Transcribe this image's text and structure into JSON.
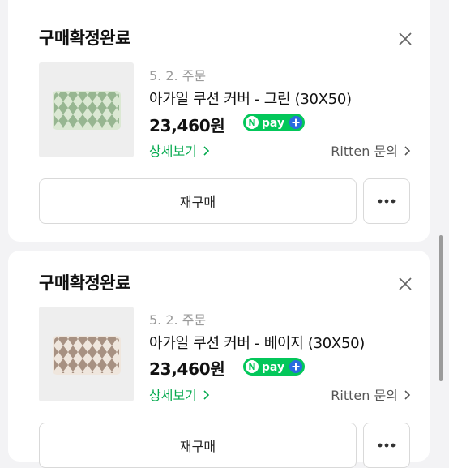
{
  "orders": [
    {
      "status": "구매확정완료",
      "date": "5. 2. 주문",
      "product_name": "아가일 쿠션 커버 - 그린 (30X50)",
      "price": "23,460원",
      "pay_badge": "pay",
      "detail_link": "상세보기",
      "seller_link": "Ritten 문의",
      "rebuy_button": "재구매",
      "pattern_color": "#8fb08a",
      "pattern_bg": "#dbe8d3"
    },
    {
      "status": "구매확정완료",
      "date": "5. 2. 주문",
      "product_name": "아가일 쿠션 커버 - 베이지 (30X50)",
      "price": "23,460원",
      "pay_badge": "pay",
      "detail_link": "상세보기",
      "seller_link": "Ritten 문의",
      "rebuy_button": "재구매",
      "pattern_color": "#9a8272",
      "pattern_bg": "#efe6dd"
    }
  ],
  "colors": {
    "accent_green": "#03a94d",
    "npay_green": "#03c75a"
  },
  "icons": {
    "close": "close-icon",
    "more": "more-icon",
    "chevron": "chevron-right-icon",
    "npay_logo": "npay-logo-icon"
  }
}
